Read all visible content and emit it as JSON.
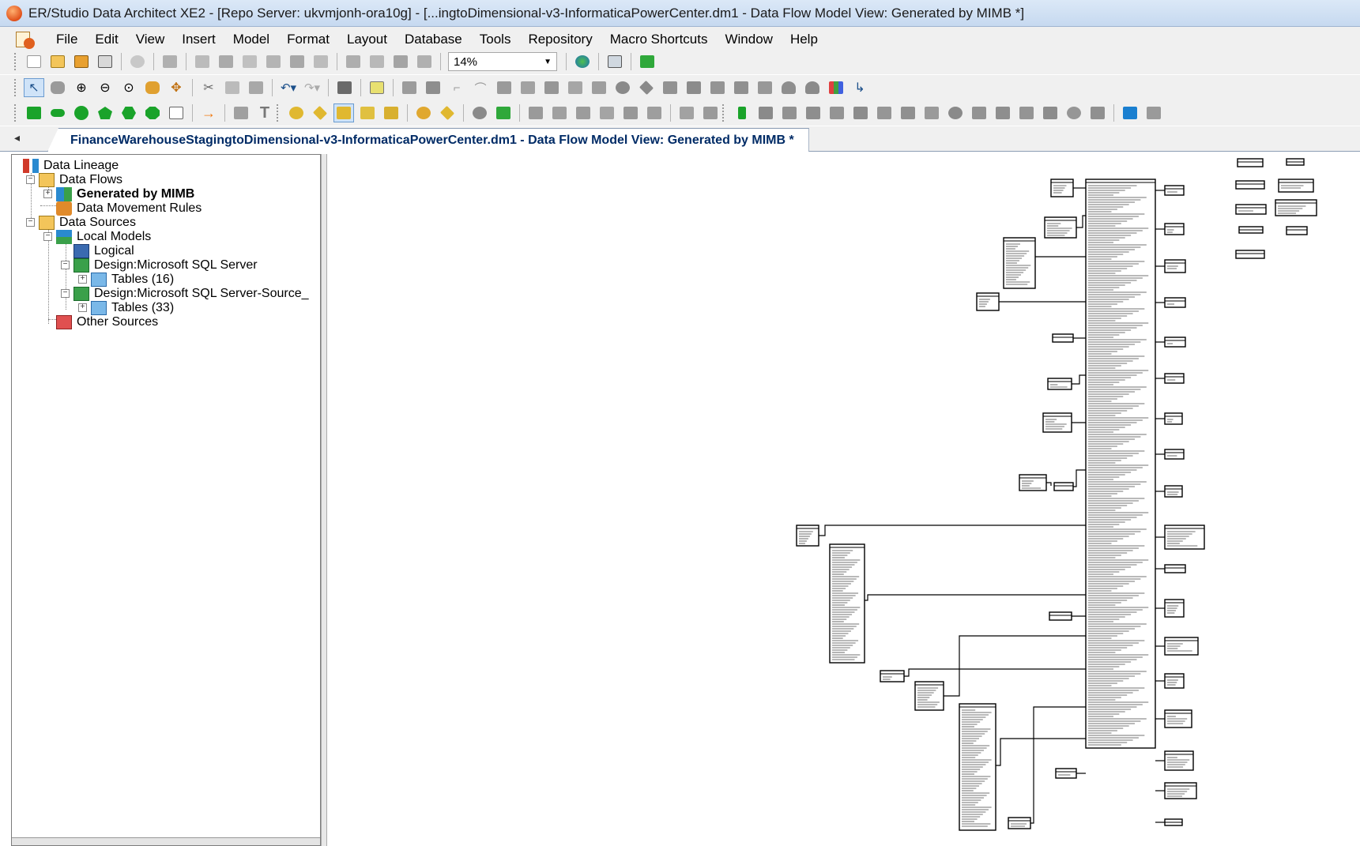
{
  "window": {
    "title": "ER/Studio Data Architect XE2 - [Repo Server: ukvmjonh-ora10g] - [...ingtoDimensional-v3-InformaticaPowerCenter.dm1 - Data Flow Model View: Generated by MIMB *]"
  },
  "menu": {
    "items": [
      "File",
      "Edit",
      "View",
      "Insert",
      "Model",
      "Format",
      "Layout",
      "Database",
      "Tools",
      "Repository",
      "Macro Shortcuts",
      "Window",
      "Help"
    ]
  },
  "toolbar": {
    "zoom_value": "14%"
  },
  "tab": {
    "scroll_left": "◂",
    "active_label": "FinanceWarehouseStagingtoDimensional-v3-InformaticaPowerCenter.dm1 - Data Flow Model View: Generated by MIMB *"
  },
  "tree": {
    "items": [
      {
        "label": "Data Lineage",
        "icon": "data-lineage-icon"
      },
      {
        "label": "Data Flows",
        "icon": "data-flows-icon"
      },
      {
        "label": "Generated by MIMB",
        "icon": "data-flow-icon"
      },
      {
        "label": "Data Movement Rules",
        "icon": "data-movement-rules-icon"
      },
      {
        "label": "Data Sources",
        "icon": "data-sources-icon"
      },
      {
        "label": "Local Models",
        "icon": "local-models-icon"
      },
      {
        "label": "Logical",
        "icon": "logical-model-icon"
      },
      {
        "label": "Design:Microsoft SQL Server",
        "icon": "physical-model-icon"
      },
      {
        "label": "Tables (16)",
        "icon": "tables-folder-icon"
      },
      {
        "label": "Design:Microsoft SQL Server-Source_",
        "icon": "physical-model-icon"
      },
      {
        "label": "Tables (33)",
        "icon": "tables-folder-icon"
      },
      {
        "label": "Other Sources",
        "icon": "other-sources-icon"
      }
    ]
  },
  "colors": {
    "title_bar": "#c6d9f0",
    "chrome": "#f0f0f0",
    "tab_text": "#002b66",
    "accent_green": "#1aa32a",
    "accent_orange": "#f07a12"
  }
}
